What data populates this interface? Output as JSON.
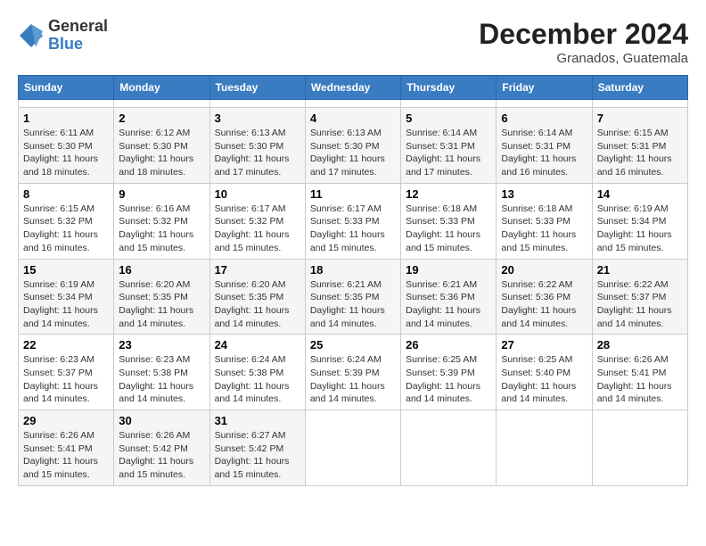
{
  "header": {
    "logo": {
      "general": "General",
      "blue": "Blue"
    },
    "title": "December 2024",
    "location": "Granados, Guatemala"
  },
  "calendar": {
    "headers": [
      "Sunday",
      "Monday",
      "Tuesday",
      "Wednesday",
      "Thursday",
      "Friday",
      "Saturday"
    ],
    "weeks": [
      [
        null,
        null,
        null,
        null,
        null,
        null,
        null
      ],
      [
        {
          "day": "1",
          "sunrise": "6:11 AM",
          "sunset": "5:30 PM",
          "daylight": "11 hours and 18 minutes."
        },
        {
          "day": "2",
          "sunrise": "6:12 AM",
          "sunset": "5:30 PM",
          "daylight": "11 hours and 18 minutes."
        },
        {
          "day": "3",
          "sunrise": "6:13 AM",
          "sunset": "5:30 PM",
          "daylight": "11 hours and 17 minutes."
        },
        {
          "day": "4",
          "sunrise": "6:13 AM",
          "sunset": "5:30 PM",
          "daylight": "11 hours and 17 minutes."
        },
        {
          "day": "5",
          "sunrise": "6:14 AM",
          "sunset": "5:31 PM",
          "daylight": "11 hours and 17 minutes."
        },
        {
          "day": "6",
          "sunrise": "6:14 AM",
          "sunset": "5:31 PM",
          "daylight": "11 hours and 16 minutes."
        },
        {
          "day": "7",
          "sunrise": "6:15 AM",
          "sunset": "5:31 PM",
          "daylight": "11 hours and 16 minutes."
        }
      ],
      [
        {
          "day": "8",
          "sunrise": "6:15 AM",
          "sunset": "5:32 PM",
          "daylight": "11 hours and 16 minutes."
        },
        {
          "day": "9",
          "sunrise": "6:16 AM",
          "sunset": "5:32 PM",
          "daylight": "11 hours and 15 minutes."
        },
        {
          "day": "10",
          "sunrise": "6:17 AM",
          "sunset": "5:32 PM",
          "daylight": "11 hours and 15 minutes."
        },
        {
          "day": "11",
          "sunrise": "6:17 AM",
          "sunset": "5:33 PM",
          "daylight": "11 hours and 15 minutes."
        },
        {
          "day": "12",
          "sunrise": "6:18 AM",
          "sunset": "5:33 PM",
          "daylight": "11 hours and 15 minutes."
        },
        {
          "day": "13",
          "sunrise": "6:18 AM",
          "sunset": "5:33 PM",
          "daylight": "11 hours and 15 minutes."
        },
        {
          "day": "14",
          "sunrise": "6:19 AM",
          "sunset": "5:34 PM",
          "daylight": "11 hours and 15 minutes."
        }
      ],
      [
        {
          "day": "15",
          "sunrise": "6:19 AM",
          "sunset": "5:34 PM",
          "daylight": "11 hours and 14 minutes."
        },
        {
          "day": "16",
          "sunrise": "6:20 AM",
          "sunset": "5:35 PM",
          "daylight": "11 hours and 14 minutes."
        },
        {
          "day": "17",
          "sunrise": "6:20 AM",
          "sunset": "5:35 PM",
          "daylight": "11 hours and 14 minutes."
        },
        {
          "day": "18",
          "sunrise": "6:21 AM",
          "sunset": "5:35 PM",
          "daylight": "11 hours and 14 minutes."
        },
        {
          "day": "19",
          "sunrise": "6:21 AM",
          "sunset": "5:36 PM",
          "daylight": "11 hours and 14 minutes."
        },
        {
          "day": "20",
          "sunrise": "6:22 AM",
          "sunset": "5:36 PM",
          "daylight": "11 hours and 14 minutes."
        },
        {
          "day": "21",
          "sunrise": "6:22 AM",
          "sunset": "5:37 PM",
          "daylight": "11 hours and 14 minutes."
        }
      ],
      [
        {
          "day": "22",
          "sunrise": "6:23 AM",
          "sunset": "5:37 PM",
          "daylight": "11 hours and 14 minutes."
        },
        {
          "day": "23",
          "sunrise": "6:23 AM",
          "sunset": "5:38 PM",
          "daylight": "11 hours and 14 minutes."
        },
        {
          "day": "24",
          "sunrise": "6:24 AM",
          "sunset": "5:38 PM",
          "daylight": "11 hours and 14 minutes."
        },
        {
          "day": "25",
          "sunrise": "6:24 AM",
          "sunset": "5:39 PM",
          "daylight": "11 hours and 14 minutes."
        },
        {
          "day": "26",
          "sunrise": "6:25 AM",
          "sunset": "5:39 PM",
          "daylight": "11 hours and 14 minutes."
        },
        {
          "day": "27",
          "sunrise": "6:25 AM",
          "sunset": "5:40 PM",
          "daylight": "11 hours and 14 minutes."
        },
        {
          "day": "28",
          "sunrise": "6:26 AM",
          "sunset": "5:41 PM",
          "daylight": "11 hours and 14 minutes."
        }
      ],
      [
        {
          "day": "29",
          "sunrise": "6:26 AM",
          "sunset": "5:41 PM",
          "daylight": "11 hours and 15 minutes."
        },
        {
          "day": "30",
          "sunrise": "6:26 AM",
          "sunset": "5:42 PM",
          "daylight": "11 hours and 15 minutes."
        },
        {
          "day": "31",
          "sunrise": "6:27 AM",
          "sunset": "5:42 PM",
          "daylight": "11 hours and 15 minutes."
        },
        null,
        null,
        null,
        null
      ]
    ]
  }
}
